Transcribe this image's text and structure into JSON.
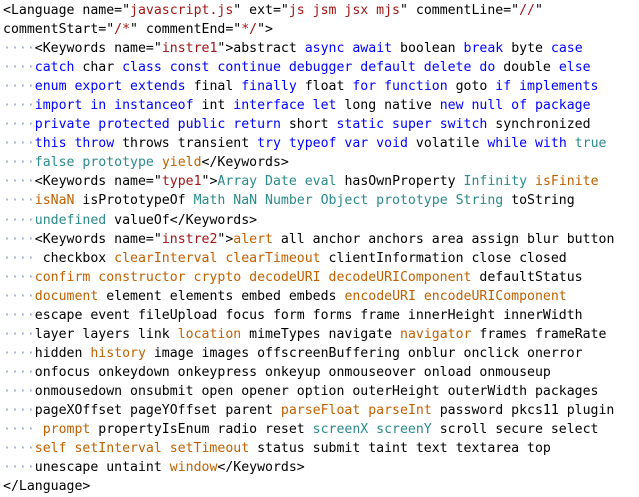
{
  "editor": {
    "colors": {
      "plain": "#000000",
      "attr_value": "#a31515",
      "keyword": "#0000ff",
      "type": "#2b8a8a",
      "builtin": "#c06000",
      "whitespace_marker": "#9aa6c8"
    },
    "lines": [
      [
        [
          "p",
          "<Language name=\""
        ],
        [
          "v",
          "javascript.js"
        ],
        [
          "p",
          "\" ext=\""
        ],
        [
          "v",
          "js jsm jsx mjs"
        ],
        [
          "p",
          "\" commentLine=\""
        ],
        [
          "v",
          "//"
        ],
        [
          "p",
          "\""
        ]
      ],
      [
        [
          "p",
          "commentStart=\""
        ],
        [
          "v",
          "/*"
        ],
        [
          "p",
          "\" commentEnd=\""
        ],
        [
          "v",
          "*/"
        ],
        [
          "p",
          "\">"
        ]
      ],
      [
        [
          "w",
          "····"
        ],
        [
          "p",
          "<Keywords name=\""
        ],
        [
          "v",
          "instre1"
        ],
        [
          "p",
          "\">abstract "
        ],
        [
          "k",
          "async await"
        ],
        [
          "p",
          " boolean "
        ],
        [
          "k",
          "break"
        ],
        [
          "p",
          " byte "
        ],
        [
          "k",
          "case"
        ]
      ],
      [
        [
          "w",
          "····"
        ],
        [
          "k",
          "catch"
        ],
        [
          "p",
          " char "
        ],
        [
          "k",
          "class const continue debugger default delete do"
        ],
        [
          "p",
          " double "
        ],
        [
          "k",
          "else"
        ]
      ],
      [
        [
          "w",
          "····"
        ],
        [
          "k",
          "enum export extends"
        ],
        [
          "p",
          " final "
        ],
        [
          "k",
          "finally"
        ],
        [
          "p",
          " float "
        ],
        [
          "k",
          "for function"
        ],
        [
          "p",
          " goto "
        ],
        [
          "k",
          "if implements"
        ]
      ],
      [
        [
          "w",
          "····"
        ],
        [
          "k",
          "import in instanceof"
        ],
        [
          "p",
          " int "
        ],
        [
          "k",
          "interface let"
        ],
        [
          "p",
          " long native "
        ],
        [
          "k",
          "new null of package"
        ]
      ],
      [
        [
          "w",
          "····"
        ],
        [
          "k",
          "private protected public return"
        ],
        [
          "p",
          " short "
        ],
        [
          "k",
          "static super switch"
        ],
        [
          "p",
          " synchronized"
        ]
      ],
      [
        [
          "w",
          "····"
        ],
        [
          "k",
          "this throw"
        ],
        [
          "p",
          " throws transient "
        ],
        [
          "k",
          "try typeof var void"
        ],
        [
          "p",
          " volatile "
        ],
        [
          "k",
          "while with"
        ],
        [
          "p",
          " "
        ],
        [
          "t",
          "true"
        ]
      ],
      [
        [
          "w",
          "····"
        ],
        [
          "t",
          "false prototype"
        ],
        [
          "p",
          " "
        ],
        [
          "b",
          "yield"
        ],
        [
          "p",
          "</Keywords>"
        ]
      ],
      [
        [
          "w",
          "····"
        ],
        [
          "p",
          "<Keywords name=\""
        ],
        [
          "v",
          "type1"
        ],
        [
          "p",
          "\">"
        ],
        [
          "t",
          "Array Date eval"
        ],
        [
          "p",
          " hasOwnProperty "
        ],
        [
          "t",
          "Infinity"
        ],
        [
          "p",
          " "
        ],
        [
          "b",
          "isFinite"
        ]
      ],
      [
        [
          "w",
          "····"
        ],
        [
          "b",
          "isNaN"
        ],
        [
          "p",
          " isPrototypeOf "
        ],
        [
          "t",
          "Math NaN Number Object prototype String"
        ],
        [
          "p",
          " toString"
        ]
      ],
      [
        [
          "w",
          "····"
        ],
        [
          "t",
          "undefined"
        ],
        [
          "p",
          " valueOf</Keywords>"
        ]
      ],
      [
        [
          "w",
          "····"
        ],
        [
          "p",
          "<Keywords name=\""
        ],
        [
          "v",
          "instre2"
        ],
        [
          "p",
          "\">"
        ],
        [
          "b",
          "alert"
        ],
        [
          "p",
          " all anchor anchors area assign blur button"
        ]
      ],
      [
        [
          "w",
          "····"
        ],
        [
          "p",
          " checkbox "
        ],
        [
          "b",
          "clearInterval clearTimeout"
        ],
        [
          "p",
          " clientInformation close closed"
        ]
      ],
      [
        [
          "w",
          "····"
        ],
        [
          "b",
          "confirm constructor crypto decodeURI decodeURIComponent"
        ],
        [
          "p",
          " defaultStatus"
        ]
      ],
      [
        [
          "w",
          "····"
        ],
        [
          "b",
          "document"
        ],
        [
          "p",
          " element elements embed embeds "
        ],
        [
          "b",
          "encodeURI encodeURIComponent"
        ]
      ],
      [
        [
          "w",
          "····"
        ],
        [
          "p",
          "escape event fileUpload focus form forms frame innerHeight innerWidth"
        ]
      ],
      [
        [
          "w",
          "····"
        ],
        [
          "p",
          "layer layers link "
        ],
        [
          "b",
          "location"
        ],
        [
          "p",
          " mimeTypes navigate "
        ],
        [
          "b",
          "navigator"
        ],
        [
          "p",
          " frames frameRate"
        ]
      ],
      [
        [
          "w",
          "····"
        ],
        [
          "p",
          "hidden "
        ],
        [
          "b",
          "history"
        ],
        [
          "p",
          " image images offscreenBuffering onblur onclick onerror"
        ]
      ],
      [
        [
          "w",
          "····"
        ],
        [
          "p",
          "onfocus onkeydown onkeypress onkeyup onmouseover onload onmouseup"
        ]
      ],
      [
        [
          "w",
          "····"
        ],
        [
          "p",
          "onmousedown onsubmit open opener option outerHeight outerWidth packages"
        ]
      ],
      [
        [
          "w",
          "····"
        ],
        [
          "p",
          "pageXOffset pageYOffset parent "
        ],
        [
          "b",
          "parseFloat parseInt"
        ],
        [
          "p",
          " password pkcs11 plugin"
        ]
      ],
      [
        [
          "w",
          "····"
        ],
        [
          "b",
          " prompt"
        ],
        [
          "p",
          " propertyIsEnum radio reset "
        ],
        [
          "t",
          "screenX screenY"
        ],
        [
          "p",
          " scroll secure select"
        ]
      ],
      [
        [
          "w",
          "····"
        ],
        [
          "b",
          "self setInterval setTimeout"
        ],
        [
          "p",
          " status submit taint text textarea top"
        ]
      ],
      [
        [
          "w",
          "····"
        ],
        [
          "p",
          "unescape untaint "
        ],
        [
          "b",
          "window"
        ],
        [
          "p",
          "</Keywords>"
        ]
      ],
      [
        [
          "p",
          "</Language>"
        ]
      ]
    ]
  }
}
